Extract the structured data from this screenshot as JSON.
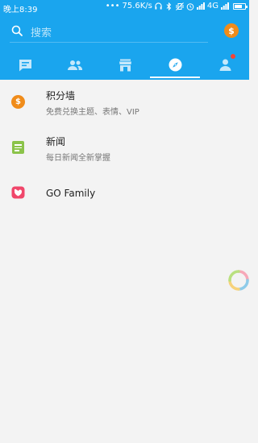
{
  "status_bar": {
    "time": "晚上8:39",
    "dots": "•••",
    "speed": "75.6K/s",
    "network": "4G"
  },
  "search": {
    "placeholder": "搜索",
    "icon": "search-icon"
  },
  "header": {
    "coin_symbol": "$",
    "accent_color": "#1aa5ee"
  },
  "tabs": [
    {
      "name": "chat",
      "icon": "chat-bubble-icon",
      "selected": false
    },
    {
      "name": "contacts",
      "icon": "contacts-icon",
      "selected": false
    },
    {
      "name": "store",
      "icon": "store-icon",
      "selected": false
    },
    {
      "name": "discover",
      "icon": "compass-icon",
      "selected": true
    },
    {
      "name": "profile",
      "icon": "person-icon",
      "selected": false,
      "has_badge": true
    }
  ],
  "list": [
    {
      "title": "积分墙",
      "subtitle": "免费兑换主题、表情、VIP",
      "icon": "coin-icon",
      "icon_color": "#f08c1a",
      "icon_symbol": "$"
    },
    {
      "title": "新闻",
      "subtitle": "每日新闻全新掌握",
      "icon": "news-icon",
      "icon_color": "#8bc34a"
    },
    {
      "title": "GO Family",
      "subtitle": "",
      "icon": "go-family-icon",
      "icon_color": "#f0466a"
    }
  ]
}
